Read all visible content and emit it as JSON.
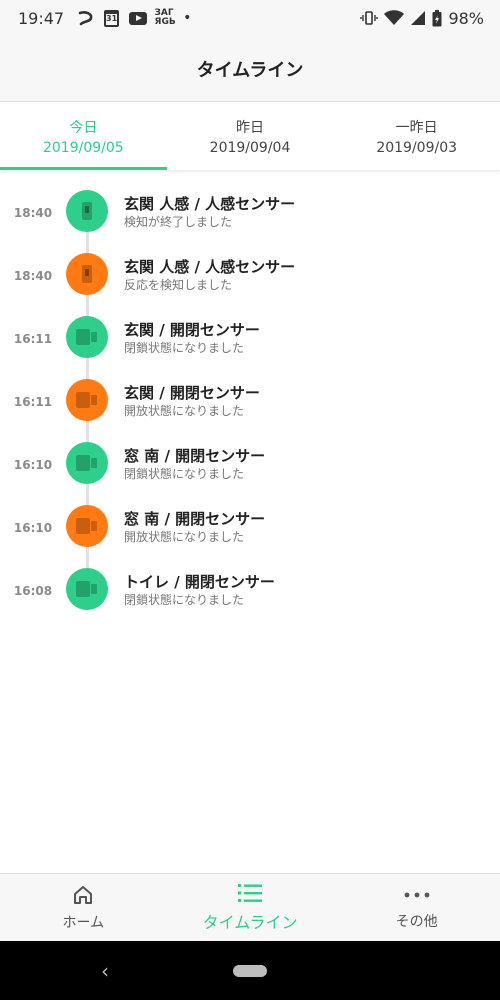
{
  "status_bar": {
    "time": "19:47",
    "calendar_day": "31",
    "small_text": "ЗАГ\nЯGЬ",
    "dot": "•",
    "battery": "98%"
  },
  "header": {
    "title": "タイムライン"
  },
  "tabs": [
    {
      "label": "今日",
      "date": "2019/09/05",
      "active": true
    },
    {
      "label": "昨日",
      "date": "2019/09/04",
      "active": false
    },
    {
      "label": "一昨日",
      "date": "2019/09/03",
      "active": false
    }
  ],
  "timeline": [
    {
      "time": "18:40",
      "title": "玄関 人感 / 人感センサー",
      "subtitle": "検知が終了しました",
      "color": "#2dcf8a",
      "icon": "motion-sensor-icon"
    },
    {
      "time": "18:40",
      "title": "玄関 人感 / 人感センサー",
      "subtitle": "反応を検知しました",
      "color": "#ff7a12",
      "icon": "motion-sensor-icon"
    },
    {
      "time": "16:11",
      "title": "玄関 / 開閉センサー",
      "subtitle": "閉鎖状態になりました",
      "color": "#2dcf8a",
      "icon": "door-sensor-icon"
    },
    {
      "time": "16:11",
      "title": "玄関 / 開閉センサー",
      "subtitle": "開放状態になりました",
      "color": "#ff7a12",
      "icon": "door-sensor-icon"
    },
    {
      "time": "16:10",
      "title": "窓 南 / 開閉センサー",
      "subtitle": "閉鎖状態になりました",
      "color": "#2dcf8a",
      "icon": "door-sensor-icon"
    },
    {
      "time": "16:10",
      "title": "窓 南 / 開閉センサー",
      "subtitle": "開放状態になりました",
      "color": "#ff7a12",
      "icon": "door-sensor-icon"
    },
    {
      "time": "16:08",
      "title": "トイレ / 開閉センサー",
      "subtitle": "閉鎖状態になりました",
      "color": "#2dcf8a",
      "icon": "door-sensor-icon"
    }
  ],
  "bottom_nav": [
    {
      "label": "ホーム",
      "icon": "home-icon",
      "active": false
    },
    {
      "label": "タイムライン",
      "icon": "list-icon",
      "active": true
    },
    {
      "label": "その他",
      "icon": "more-icon",
      "active": false
    }
  ],
  "colors": {
    "accent": "#2dcf8a",
    "alert": "#ff7a12"
  },
  "system_nav": {
    "back": "‹"
  }
}
